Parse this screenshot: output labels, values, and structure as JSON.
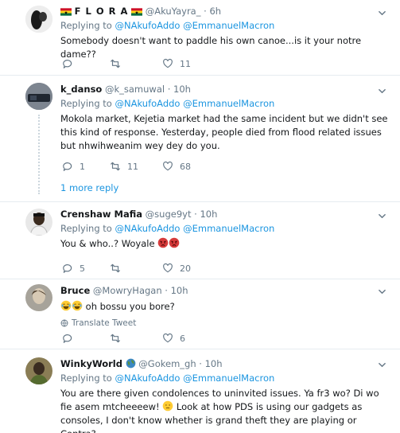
{
  "tweets": [
    {
      "name": "F L O R A",
      "handle": "@AkuYayra_",
      "time": "6h",
      "replying_label": "Replying to",
      "mention1": "@NAkufoAddo",
      "mention2": "@EmmanuelMacron",
      "text": "Somebody doesn't want to paddle his own canoe...is it your notre dame??",
      "replies": "",
      "retweets": "",
      "likes": "11"
    },
    {
      "name": "k_danso",
      "handle": "@k_samuwal",
      "time": "10h",
      "replying_label": "Replying to",
      "mention1": "@NAkufoAddo",
      "mention2": "@EmmanuelMacron",
      "text": "Mokola market, Kejetia market had the same incident but we didn't see this kind of response. Yesterday, people died from flood related issues but nhwihweanim wey dey do you.",
      "replies": "1",
      "retweets": "11",
      "likes": "68",
      "more_replies": "1 more reply"
    },
    {
      "name": "Crenshaw Mafia",
      "handle": "@suge9yt",
      "time": "10h",
      "replying_label": "Replying to",
      "mention1": "@NAkufoAddo",
      "mention2": "@EmmanuelMacron",
      "text": "You & who..? Woyale",
      "replies": "5",
      "retweets": "",
      "likes": "20"
    },
    {
      "name": "Bruce",
      "handle": "@MowryHagan",
      "time": "10h",
      "text": "oh bossu you bore?",
      "translate": "Translate Tweet",
      "replies": "",
      "retweets": "",
      "likes": "6"
    },
    {
      "name": "WinkyWorld",
      "handle": "@Gokem_gh",
      "time": "10h",
      "replying_label": "Replying to",
      "mention1": "@NAkufoAddo",
      "mention2": "@EmmanuelMacron",
      "text_a": "You are there given condolences to uninvited issues. Ya fr3 wo? Di wo fie asem mtcheeeew!",
      "text_b": "Look at how PDS is using our gadgets as consoles, I don't know whether is grand theft they are playing or Contra?"
    }
  ],
  "colors": {
    "link": "#1b95e0",
    "meta": "#657786",
    "divider": "#e6ecf0"
  },
  "icons": [
    "ghana-flag-icon",
    "reply-icon",
    "retweet-icon",
    "like-icon",
    "caret-down-icon",
    "globe-icon",
    "face-with-tears-of-joy-emoji",
    "angry-face-emoji",
    "disappointed-face-emoji"
  ]
}
